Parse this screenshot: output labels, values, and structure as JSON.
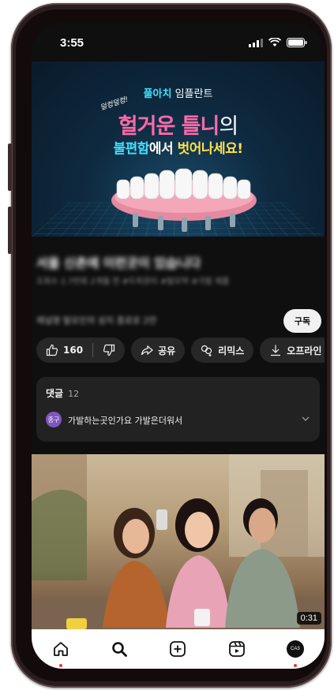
{
  "status": {
    "time": "3:55"
  },
  "ad": {
    "brand_accent": "풀아치",
    "brand_rest": "임플란트",
    "script_text": "덜컹덜컹!",
    "line1_pink": "헐거운 틀니",
    "line1_white": "의",
    "line2_cyan": "불편함",
    "line2_white": "에서 ",
    "line2_yellow": "벗어나세요!"
  },
  "video": {
    "title": "서울 신촌에 이런곳이 있습니다",
    "meta": "조회수 2.7만회  2개월 전  #두피관리  #탈모약  #가발 제품",
    "channel": "채널명  탈모인의 성지 종로로  2만"
  },
  "subscribe_label": "구독",
  "actions": {
    "like_count": "160",
    "share": "공유",
    "remix": "리믹스",
    "download": "오프라인 저장"
  },
  "comments": {
    "heading": "댓글",
    "count": "12",
    "avatar_text": "종구",
    "first_comment": "가발하는곳인가요 가발은더워서"
  },
  "next_video": {
    "duration": "0:31"
  },
  "nav": {
    "profile_initials": "CA3"
  },
  "colors": {
    "accent_pink": "#ff6aa8",
    "accent_cyan": "#42e0ff",
    "accent_yellow": "#ffe14a",
    "dark_bg": "#0f0f0f"
  }
}
